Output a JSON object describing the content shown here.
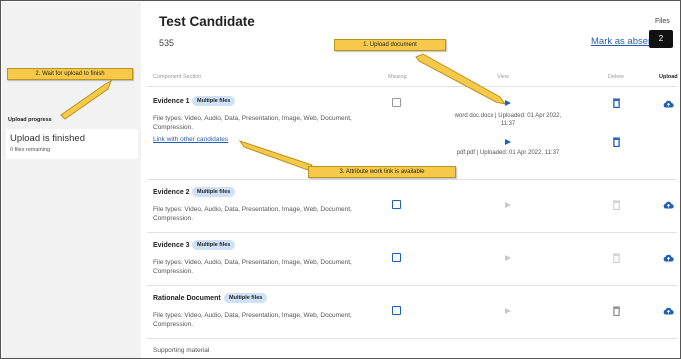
{
  "candidate": {
    "name": "Test Candidate",
    "number": "535"
  },
  "header": {
    "mark_absent": "Mark as absent",
    "files_label": "Files",
    "files_count": "2"
  },
  "table": {
    "columns": {
      "component": "Component Section",
      "missing": "Missing",
      "view": "View",
      "delete": "Delete",
      "upload": "Upload"
    },
    "rows": [
      {
        "title": "Evidence 1",
        "badge": "Multiple files",
        "desc": "File types: Video, Audio, Data, Presentation, Image, Web, Document, Compression.",
        "link": "Link with other candidates",
        "files": [
          "word doc.docx | Uploaded: 01 Apr 2022, 11:37",
          "pdf.pdf | Uploaded: 01 Apr 2022, 11:37"
        ]
      },
      {
        "title": "Evidence 2",
        "badge": "Multiple files",
        "desc": "File types: Video, Audio, Data, Presentation, Image, Web, Document, Compression."
      },
      {
        "title": "Evidence 3",
        "badge": "Multiple files",
        "desc": "File types: Video, Audio, Data, Presentation, Image, Web, Document, Compression."
      },
      {
        "title": "Rationale Document",
        "badge": "Multiple files",
        "desc": "File types: Video, Audio, Data, Presentation, Image, Web, Document, Compression."
      }
    ],
    "supporting": "Supporting material"
  },
  "sidebar": {
    "progress_label": "Upload progress",
    "status": "Upload is finished",
    "remaining": "0 files remaining"
  },
  "callouts": {
    "c1": "1. Upload document",
    "c2": "2. Wait for upload to finish",
    "c3": "3. Attribute work link is available"
  },
  "colors": {
    "accent": "#1f5fb5",
    "callout": "#f7c94a",
    "badge": "#cfe1f7"
  }
}
